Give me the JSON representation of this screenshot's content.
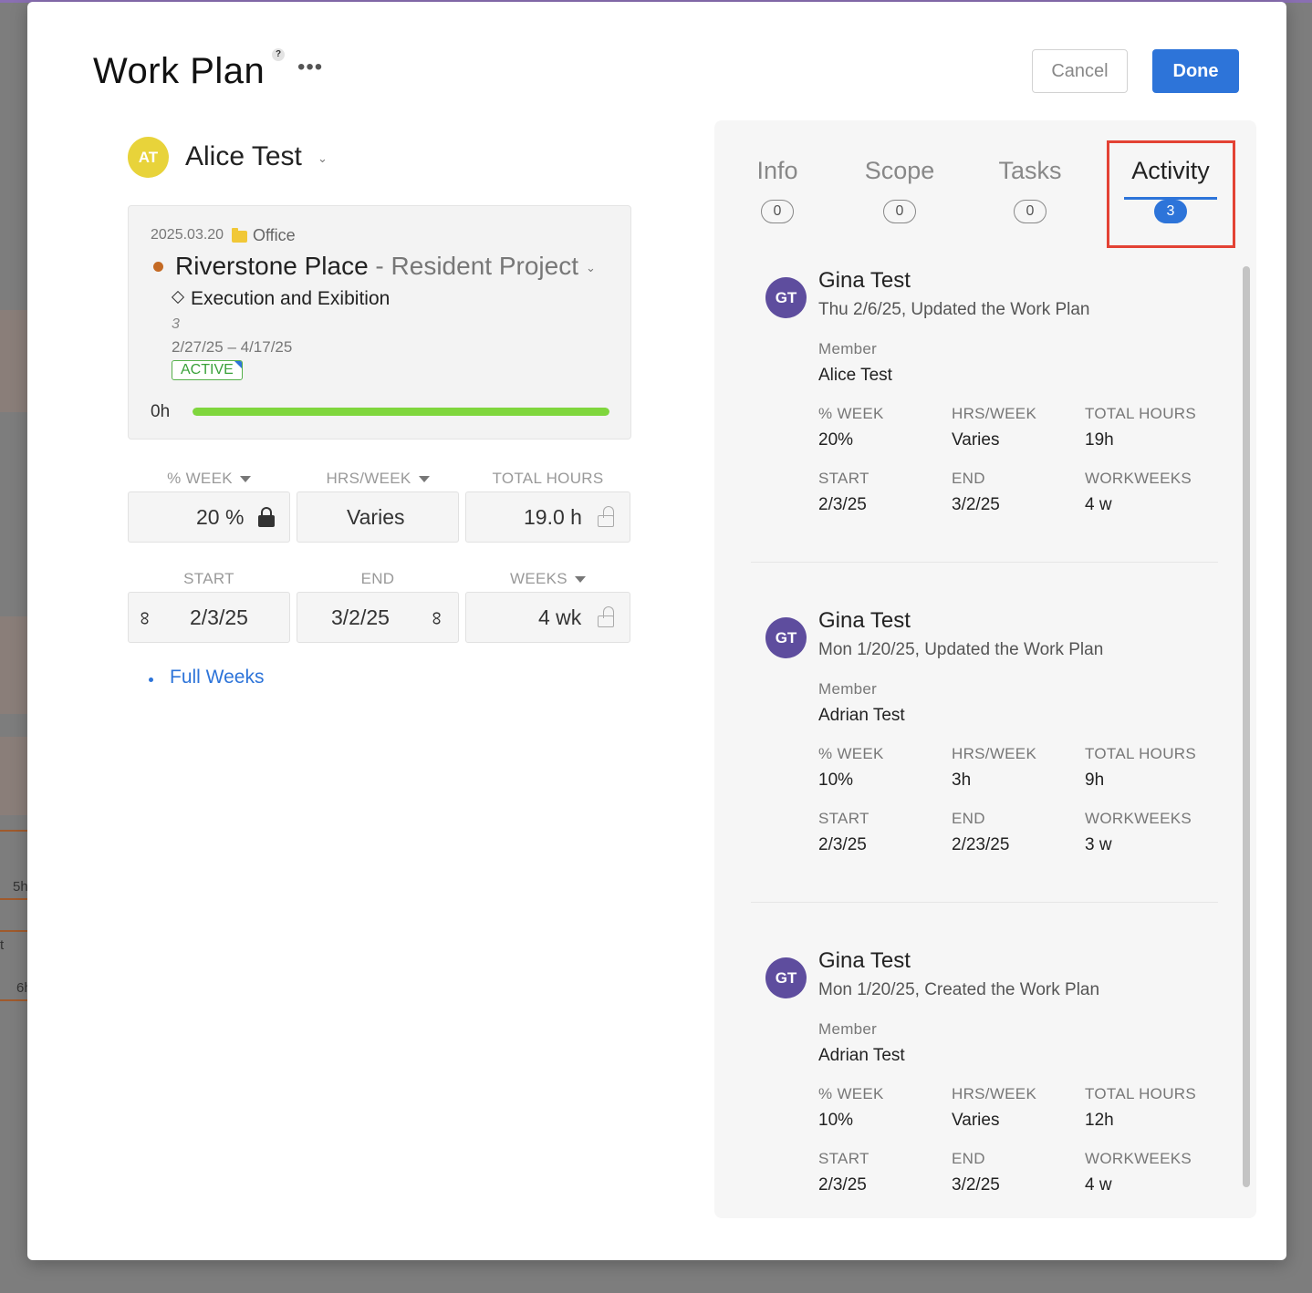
{
  "modal": {
    "title": "Work Plan",
    "help_icon": "?",
    "more_icon": "•••",
    "cancel_label": "Cancel",
    "done_label": "Done"
  },
  "member": {
    "initials": "AT",
    "name": "Alice Test",
    "avatar_color": "#e8d33a"
  },
  "project_card": {
    "date": "2025.03.20",
    "folder_icon": "folder-icon",
    "office": "Office",
    "project_name": "Riverstone Place",
    "project_sub": " - Resident Project",
    "project_color": "#c46a24",
    "phase": "Execution and Exibition",
    "number": "3",
    "date_range": "2/27/25 – 4/17/25",
    "status": "ACTIVE",
    "hours": "0h",
    "progress_percent": 100
  },
  "fields": {
    "pct_week_label": "% WEEK",
    "hrs_week_label": "HRS/WEEK",
    "total_hours_label": "TOTAL HOURS",
    "pct_week_value": "20 %",
    "hrs_week_value": "Varies",
    "total_hours_value": "19.0 h",
    "start_label": "START",
    "end_label": "END",
    "weeks_label": "WEEKS",
    "start_value": "2/3/25",
    "end_value": "3/2/25",
    "weeks_value": "4 wk"
  },
  "full_weeks_label": "Full Weeks",
  "tabs": [
    {
      "label": "Info",
      "count": "0"
    },
    {
      "label": "Scope",
      "count": "0"
    },
    {
      "label": "Tasks",
      "count": "0"
    },
    {
      "label": "Activity",
      "count": "3",
      "active": true
    }
  ],
  "activity_labels": {
    "member": "Member",
    "pct_week": "% WEEK",
    "hrs_week": "HRS/WEEK",
    "total_hours": "TOTAL HOURS",
    "start": "START",
    "end": "END",
    "workweeks": "WORKWEEKS"
  },
  "activity": [
    {
      "initials": "GT",
      "name": "Gina Test",
      "action": "Thu 2/6/25, Updated the Work Plan",
      "member": "Alice Test",
      "pct_week": "20%",
      "hrs_week": "Varies",
      "total_hours": "19h",
      "start": "2/3/25",
      "end": "3/2/25",
      "workweeks": "4 w"
    },
    {
      "initials": "GT",
      "name": "Gina Test",
      "action": "Mon 1/20/25, Updated the Work Plan",
      "member": "Adrian Test",
      "pct_week": "10%",
      "hrs_week": "3h",
      "total_hours": "9h",
      "start": "2/3/25",
      "end": "2/23/25",
      "workweeks": "3 w"
    },
    {
      "initials": "GT",
      "name": "Gina Test",
      "action": "Mon 1/20/25, Created the Work Plan",
      "member": "Adrian Test",
      "pct_week": "10%",
      "hrs_week": "Varies",
      "total_hours": "12h",
      "start": "2/3/25",
      "end": "3/2/25",
      "workweeks": "4 w"
    }
  ],
  "background": {
    "label_a": "5h",
    "label_b": "t",
    "label_c": "6h"
  }
}
